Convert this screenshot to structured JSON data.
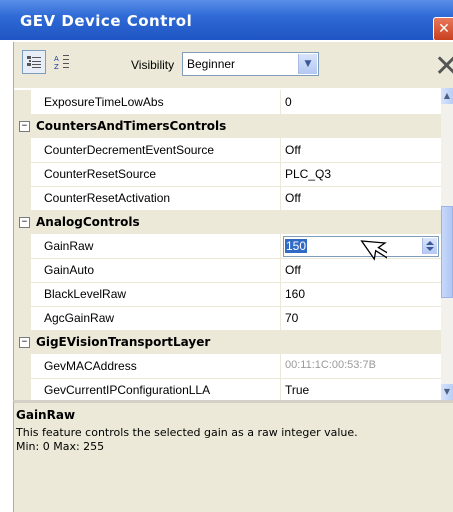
{
  "window": {
    "title": "GEV Device Control",
    "close_glyph": "✕"
  },
  "toolbar": {
    "categorized_icon": "categorized-view-icon",
    "sort_icon": "alphabetical-sort-icon",
    "visibility_label": "Visibility",
    "visibility_value": "Beginner",
    "delete_icon": "delete-x-icon"
  },
  "grid": {
    "rows": [
      {
        "kind": "prop",
        "name": "ExposureTimeLowAbs",
        "value": "0"
      },
      {
        "kind": "cat",
        "name": "CountersAndTimersControls"
      },
      {
        "kind": "prop",
        "name": "CounterDecrementEventSource",
        "value": "Off"
      },
      {
        "kind": "prop",
        "name": "CounterResetSource",
        "value": "PLC_Q3"
      },
      {
        "kind": "prop",
        "name": "CounterResetActivation",
        "value": "Off"
      },
      {
        "kind": "cat",
        "name": "AnalogControls"
      },
      {
        "kind": "edit",
        "name": "GainRaw",
        "value": "150"
      },
      {
        "kind": "prop",
        "name": "GainAuto",
        "value": "Off"
      },
      {
        "kind": "prop",
        "name": "BlackLevelRaw",
        "value": "160"
      },
      {
        "kind": "prop",
        "name": "AgcGainRaw",
        "value": "70"
      },
      {
        "kind": "cat",
        "name": "GigEVisionTransportLayer"
      },
      {
        "kind": "prop",
        "name": "GevMACAddress",
        "value": "00:11:1C:00:53:7B",
        "readonly": true
      },
      {
        "kind": "prop",
        "name": "GevCurrentIPConfigurationLLA",
        "value": "True"
      }
    ]
  },
  "help": {
    "title": "GainRaw",
    "description": "This feature controls the selected gain as a raw integer value.",
    "range": "Min: 0 Max: 255"
  }
}
